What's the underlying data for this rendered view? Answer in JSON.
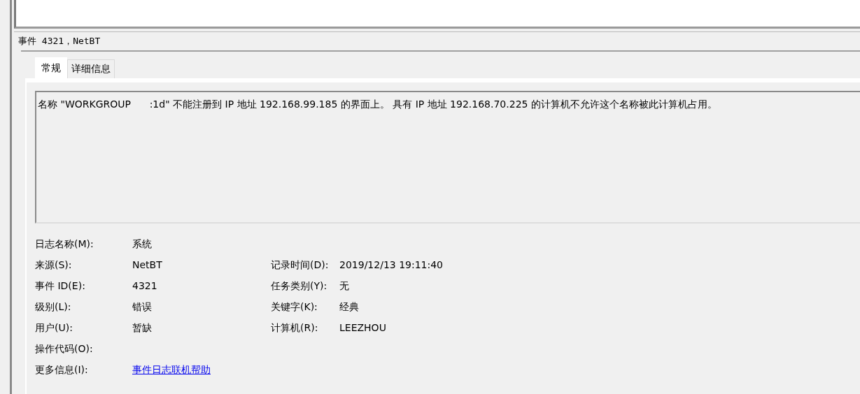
{
  "header": {
    "title": "事件 4321，NetBT"
  },
  "tabs": [
    {
      "label": "常规",
      "selected": true
    },
    {
      "label": "详细信息",
      "selected": false
    }
  ],
  "message": "名称 \"WORKGROUP      :1d\" 不能注册到 IP 地址 192.168.99.185 的界面上。 具有 IP 地址 192.168.70.225 的计算机不允许这个名称被此计算机占用。",
  "properties": [
    {
      "label": "日志名称(M):",
      "value": "系统",
      "kind": "text"
    },
    {
      "label": "来源(S):",
      "value": "NetBT",
      "kind": "text",
      "right": {
        "label": "记录时间(D):",
        "value": "2019/12/13 19:11:40"
      }
    },
    {
      "label": "事件 ID(E):",
      "value": "4321",
      "kind": "text",
      "right": {
        "label": "任务类别(Y):",
        "value": "无"
      }
    },
    {
      "label": "级别(L):",
      "value": "错误",
      "kind": "text",
      "right": {
        "label": "关键字(K):",
        "value": "经典"
      }
    },
    {
      "label": "用户(U):",
      "value": "暂缺",
      "kind": "text",
      "right": {
        "label": "计算机(R):",
        "value": "LEEZHOU"
      }
    },
    {
      "label": "操作代码(O):",
      "kind": "text"
    },
    {
      "label": "更多信息(I):",
      "value": "事件日志联机帮助",
      "kind": "link"
    }
  ]
}
